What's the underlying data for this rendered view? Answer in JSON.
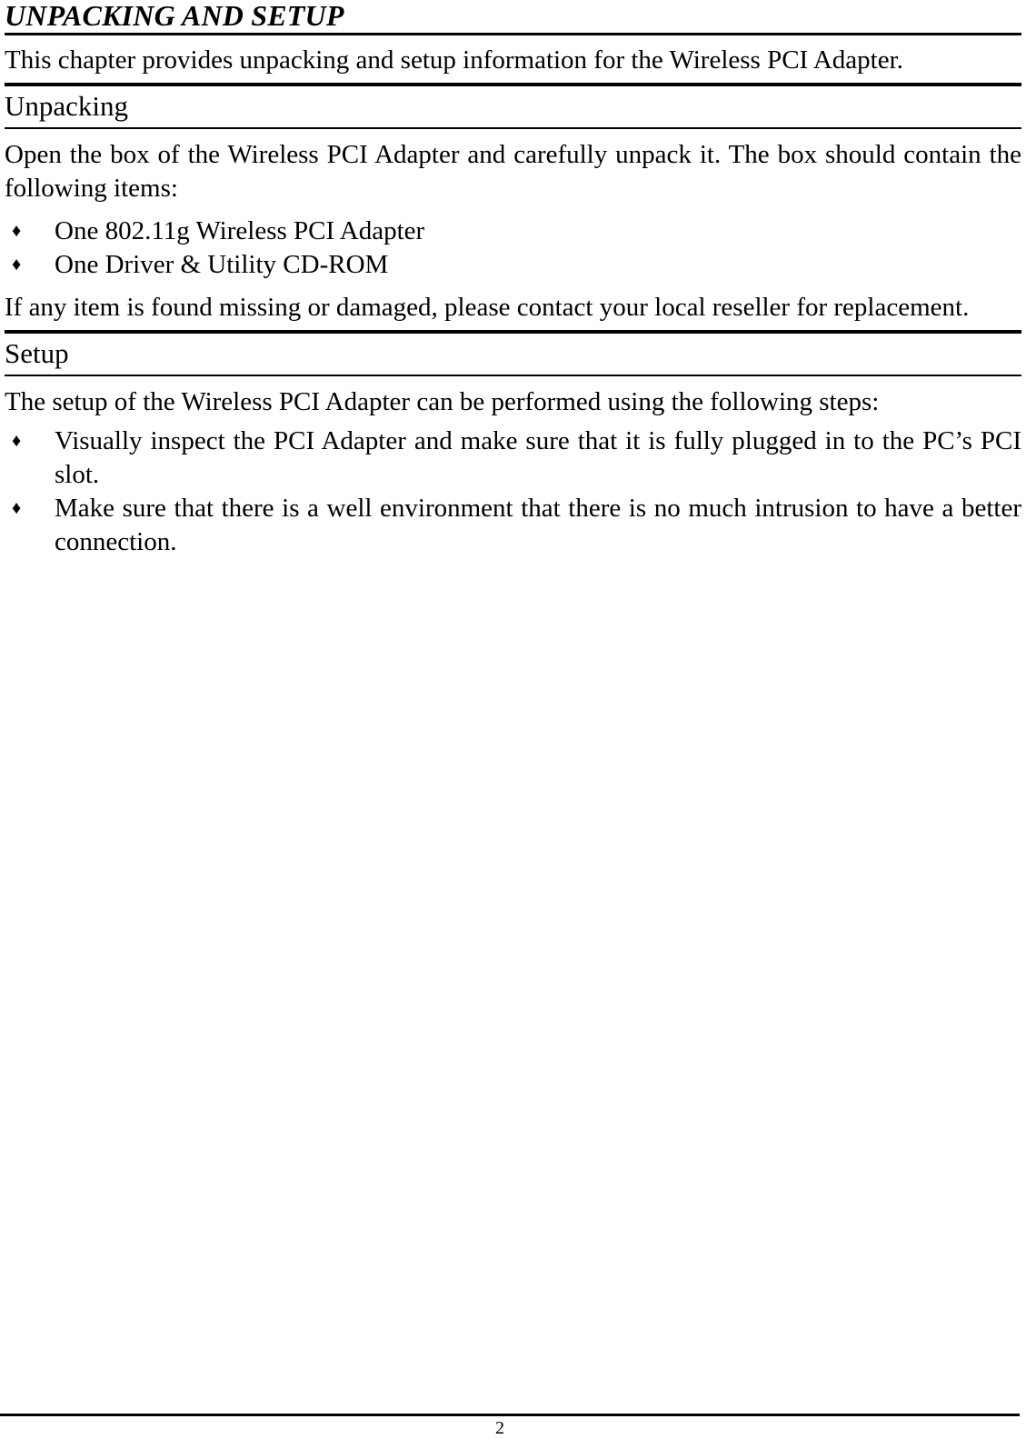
{
  "document": {
    "chapter_title": "UNPACKING AND SETUP",
    "intro_paragraph": "This chapter provides unpacking and setup information for the Wireless PCI Adapter.",
    "sections": [
      {
        "heading": "Unpacking",
        "intro": "Open the box of the Wireless PCI Adapter and carefully unpack it. The box should contain the following items:",
        "bullets": [
          "One 802.11g Wireless PCI Adapter",
          "One Driver & Utility CD-ROM"
        ],
        "closing": "If any item is found missing or damaged, please contact your local reseller for replacement."
      },
      {
        "heading": "Setup",
        "intro": "The setup of the Wireless PCI Adapter can be performed using the following steps:",
        "bullets": [
          "Visually inspect the PCI Adapter and make sure that it is fully plugged in to the PC’s PCI slot.",
          "Make sure that there is a well environment that there is no much intrusion to have a better connection."
        ],
        "closing": ""
      }
    ],
    "bullet_glyph": "♦",
    "footer": {
      "page_number": "2"
    },
    "colors": {
      "text": "#000000",
      "rule": "#000000",
      "background": "#ffffff"
    }
  }
}
